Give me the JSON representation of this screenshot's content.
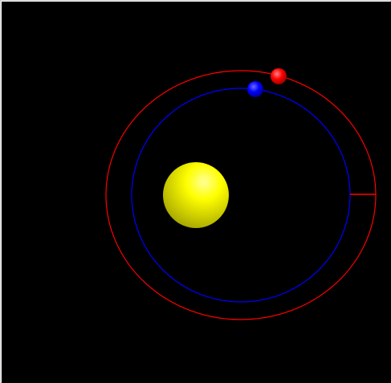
{
  "scene": {
    "background_color": "#000000",
    "sun": {
      "color": "#ffff00",
      "highlight": "#ffff99",
      "shadow": "#a6a600"
    },
    "orbits": [
      {
        "name": "outer",
        "color": "#ff0000"
      },
      {
        "name": "inner",
        "color": "#0000ff"
      }
    ],
    "planets": [
      {
        "name": "outer-planet",
        "color": "#ff0000",
        "highlight": "#ff8080",
        "shadow": "#800000"
      },
      {
        "name": "inner-planet",
        "color": "#0000ff",
        "highlight": "#6a6aff",
        "shadow": "#000070"
      }
    ]
  }
}
